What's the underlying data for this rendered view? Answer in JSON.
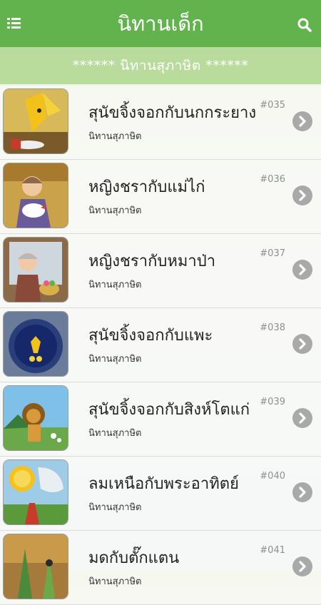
{
  "header": {
    "title": "นิทานเด็ก",
    "menu_icon": "list-menu-icon",
    "search_icon": "search-icon"
  },
  "subheader": {
    "text": "******  นิทานสุภาษิต   ******"
  },
  "items": [
    {
      "title": "สุนัขจิ้งจอกกับนกกระยาง",
      "category": "นิทานสุภาษิต",
      "number": "#035"
    },
    {
      "title": "หญิงชรากับแม่ไก่",
      "category": "นิทานสุภาษิต",
      "number": "#036"
    },
    {
      "title": "หญิงชรากับหมาป่า",
      "category": "นิทานสุภาษิต",
      "number": "#037"
    },
    {
      "title": "สุนัขจิ้งจอกกับแพะ",
      "category": "นิทานสุภาษิต",
      "number": "#038"
    },
    {
      "title": "สุนัขจิ้งจอกกับสิงห์โตแก่",
      "category": "นิทานสุภาษิต",
      "number": "#039"
    },
    {
      "title": "ลมเหนือกับพระอาทิตย์",
      "category": "นิทานสุภาษิต",
      "number": "#040"
    },
    {
      "title": "มดกับตั๊กแตน",
      "category": "นิทานสุภาษิต",
      "number": "#041"
    }
  ],
  "colors": {
    "header_bg": "#62b34e",
    "subheader_bg": "#b9dc9c",
    "chevron_bg": "#a9a9a9"
  }
}
